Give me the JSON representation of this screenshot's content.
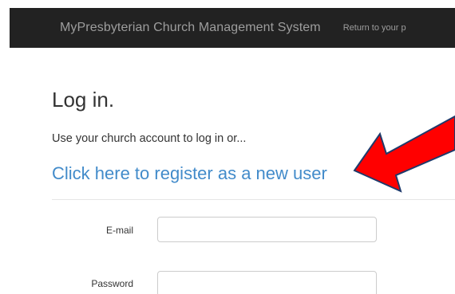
{
  "header": {
    "brand": "MyPresbyterian  Church Management System",
    "return_link": "Return to your p"
  },
  "login": {
    "title": "Log in.",
    "subtitle": "Use your church account to log in or...",
    "register_link": "Click here to register as a new user"
  },
  "form": {
    "email_label": "E-mail",
    "email_value": "",
    "password_label": "Password",
    "password_value": ""
  },
  "annotation": {
    "arrow_color": "#ff0000",
    "arrow_outline": "#1f3a6b",
    "icon": "red-arrow-icon"
  },
  "colors": {
    "navbar": "#222222",
    "link": "#428bca"
  }
}
